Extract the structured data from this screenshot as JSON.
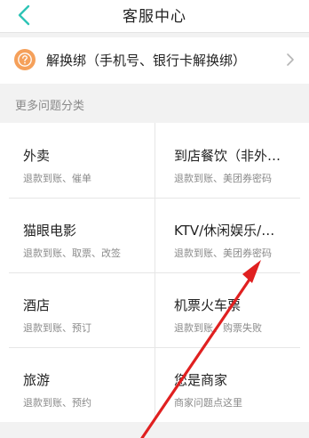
{
  "header": {
    "title": "客服中心",
    "back_icon": "chevron-left-icon",
    "accent_color": "#2ec4b6"
  },
  "banner": {
    "label": "解换绑（手机号、银行卡解换绑）",
    "icon": "help-icon",
    "icon_color": "#f5a05a"
  },
  "section": {
    "label": "更多问题分类"
  },
  "categories": [
    {
      "title": "外卖",
      "subtitle": "退款到账、催单"
    },
    {
      "title": "到店餐饮（非外…",
      "subtitle": "退款到账、美团券密码"
    },
    {
      "title": "猫眼电影",
      "subtitle": "退款到账、取票、改签"
    },
    {
      "title": "KTV/休闲娱乐/…",
      "subtitle": "退款到账、美团券密码"
    },
    {
      "title": "酒店",
      "subtitle": "退款到账、预订"
    },
    {
      "title": "机票火车票",
      "subtitle": "退款到账、购票失败"
    },
    {
      "title": "旅游",
      "subtitle": "退款到账、预约"
    },
    {
      "title": "您是商家",
      "subtitle": "商家问题点这里"
    }
  ],
  "annotation": {
    "arrow_color": "#e02020"
  }
}
